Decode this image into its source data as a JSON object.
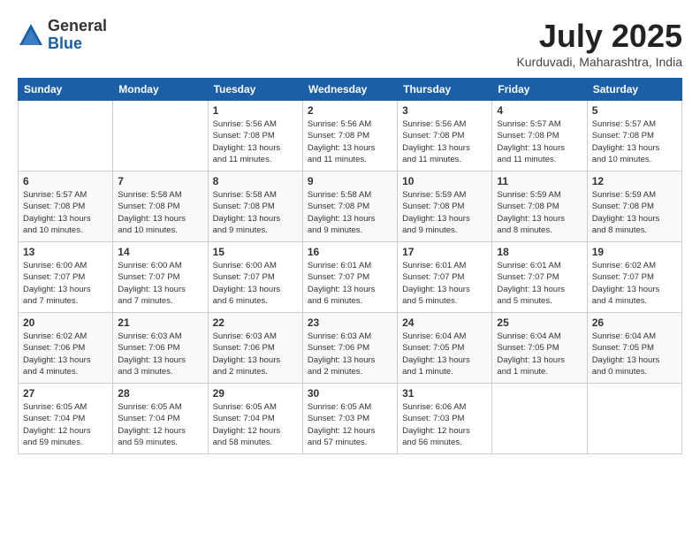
{
  "header": {
    "logo_general": "General",
    "logo_blue": "Blue",
    "month_year": "July 2025",
    "location": "Kurduvadi, Maharashtra, India"
  },
  "weekdays": [
    "Sunday",
    "Monday",
    "Tuesday",
    "Wednesday",
    "Thursday",
    "Friday",
    "Saturday"
  ],
  "weeks": [
    [
      {
        "day": "",
        "info": ""
      },
      {
        "day": "",
        "info": ""
      },
      {
        "day": "1",
        "info": "Sunrise: 5:56 AM\nSunset: 7:08 PM\nDaylight: 13 hours\nand 11 minutes."
      },
      {
        "day": "2",
        "info": "Sunrise: 5:56 AM\nSunset: 7:08 PM\nDaylight: 13 hours\nand 11 minutes."
      },
      {
        "day": "3",
        "info": "Sunrise: 5:56 AM\nSunset: 7:08 PM\nDaylight: 13 hours\nand 11 minutes."
      },
      {
        "day": "4",
        "info": "Sunrise: 5:57 AM\nSunset: 7:08 PM\nDaylight: 13 hours\nand 11 minutes."
      },
      {
        "day": "5",
        "info": "Sunrise: 5:57 AM\nSunset: 7:08 PM\nDaylight: 13 hours\nand 10 minutes."
      }
    ],
    [
      {
        "day": "6",
        "info": "Sunrise: 5:57 AM\nSunset: 7:08 PM\nDaylight: 13 hours\nand 10 minutes."
      },
      {
        "day": "7",
        "info": "Sunrise: 5:58 AM\nSunset: 7:08 PM\nDaylight: 13 hours\nand 10 minutes."
      },
      {
        "day": "8",
        "info": "Sunrise: 5:58 AM\nSunset: 7:08 PM\nDaylight: 13 hours\nand 9 minutes."
      },
      {
        "day": "9",
        "info": "Sunrise: 5:58 AM\nSunset: 7:08 PM\nDaylight: 13 hours\nand 9 minutes."
      },
      {
        "day": "10",
        "info": "Sunrise: 5:59 AM\nSunset: 7:08 PM\nDaylight: 13 hours\nand 9 minutes."
      },
      {
        "day": "11",
        "info": "Sunrise: 5:59 AM\nSunset: 7:08 PM\nDaylight: 13 hours\nand 8 minutes."
      },
      {
        "day": "12",
        "info": "Sunrise: 5:59 AM\nSunset: 7:08 PM\nDaylight: 13 hours\nand 8 minutes."
      }
    ],
    [
      {
        "day": "13",
        "info": "Sunrise: 6:00 AM\nSunset: 7:07 PM\nDaylight: 13 hours\nand 7 minutes."
      },
      {
        "day": "14",
        "info": "Sunrise: 6:00 AM\nSunset: 7:07 PM\nDaylight: 13 hours\nand 7 minutes."
      },
      {
        "day": "15",
        "info": "Sunrise: 6:00 AM\nSunset: 7:07 PM\nDaylight: 13 hours\nand 6 minutes."
      },
      {
        "day": "16",
        "info": "Sunrise: 6:01 AM\nSunset: 7:07 PM\nDaylight: 13 hours\nand 6 minutes."
      },
      {
        "day": "17",
        "info": "Sunrise: 6:01 AM\nSunset: 7:07 PM\nDaylight: 13 hours\nand 5 minutes."
      },
      {
        "day": "18",
        "info": "Sunrise: 6:01 AM\nSunset: 7:07 PM\nDaylight: 13 hours\nand 5 minutes."
      },
      {
        "day": "19",
        "info": "Sunrise: 6:02 AM\nSunset: 7:07 PM\nDaylight: 13 hours\nand 4 minutes."
      }
    ],
    [
      {
        "day": "20",
        "info": "Sunrise: 6:02 AM\nSunset: 7:06 PM\nDaylight: 13 hours\nand 4 minutes."
      },
      {
        "day": "21",
        "info": "Sunrise: 6:03 AM\nSunset: 7:06 PM\nDaylight: 13 hours\nand 3 minutes."
      },
      {
        "day": "22",
        "info": "Sunrise: 6:03 AM\nSunset: 7:06 PM\nDaylight: 13 hours\nand 2 minutes."
      },
      {
        "day": "23",
        "info": "Sunrise: 6:03 AM\nSunset: 7:06 PM\nDaylight: 13 hours\nand 2 minutes."
      },
      {
        "day": "24",
        "info": "Sunrise: 6:04 AM\nSunset: 7:05 PM\nDaylight: 13 hours\nand 1 minute."
      },
      {
        "day": "25",
        "info": "Sunrise: 6:04 AM\nSunset: 7:05 PM\nDaylight: 13 hours\nand 1 minute."
      },
      {
        "day": "26",
        "info": "Sunrise: 6:04 AM\nSunset: 7:05 PM\nDaylight: 13 hours\nand 0 minutes."
      }
    ],
    [
      {
        "day": "27",
        "info": "Sunrise: 6:05 AM\nSunset: 7:04 PM\nDaylight: 12 hours\nand 59 minutes."
      },
      {
        "day": "28",
        "info": "Sunrise: 6:05 AM\nSunset: 7:04 PM\nDaylight: 12 hours\nand 59 minutes."
      },
      {
        "day": "29",
        "info": "Sunrise: 6:05 AM\nSunset: 7:04 PM\nDaylight: 12 hours\nand 58 minutes."
      },
      {
        "day": "30",
        "info": "Sunrise: 6:05 AM\nSunset: 7:03 PM\nDaylight: 12 hours\nand 57 minutes."
      },
      {
        "day": "31",
        "info": "Sunrise: 6:06 AM\nSunset: 7:03 PM\nDaylight: 12 hours\nand 56 minutes."
      },
      {
        "day": "",
        "info": ""
      },
      {
        "day": "",
        "info": ""
      }
    ]
  ]
}
